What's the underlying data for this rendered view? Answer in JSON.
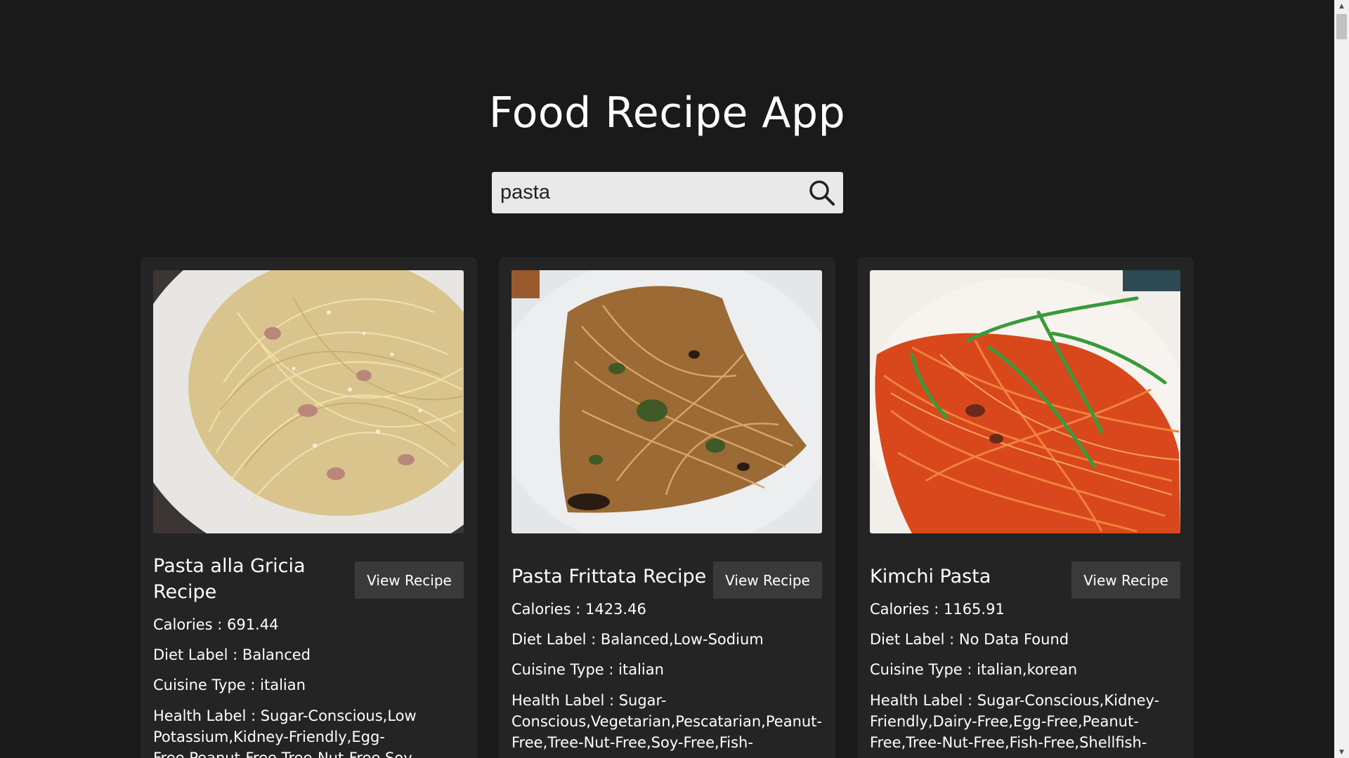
{
  "app": {
    "title": "Food Recipe App"
  },
  "search": {
    "value": "pasta",
    "icon": "magnifier"
  },
  "recipes": [
    {
      "title": "Pasta alla Gricia Recipe",
      "button_label": "View Recipe",
      "calories": "Calories : 691.44",
      "diet": "Diet Label : Balanced",
      "cuisine": "Cuisine Type : italian",
      "health": "Health Label : Sugar-Conscious,Low Potassium,Kidney-Friendly,Egg-Free,Peanut-Free,Tree-Nut-Free,Soy-",
      "image_colors": [
        "#d8c79a",
        "#efe3bd",
        "#3a3330"
      ]
    },
    {
      "title": "Pasta Frittata Recipe",
      "button_label": "View Recipe",
      "calories": "Calories : 1423.46",
      "diet": "Diet Label : Balanced,Low-Sodium",
      "cuisine": "Cuisine Type : italian",
      "health": "Health Label : Sugar-Conscious,Vegetarian,Pescatarian,Peanut-Free,Tree-Nut-Free,Soy-Free,Fish-",
      "image_colors": [
        "#b98448",
        "#e9ecef",
        "#3d4a25"
      ]
    },
    {
      "title": "Kimchi Pasta",
      "button_label": "View Recipe",
      "calories": "Calories : 1165.91",
      "diet": "Diet Label : No Data Found",
      "cuisine": "Cuisine Type : italian,korean",
      "health": "Health Label : Sugar-Conscious,Kidney-Friendly,Dairy-Free,Egg-Free,Peanut-Free,Tree-Nut-Free,Fish-Free,Shellfish-",
      "image_colors": [
        "#e0622b",
        "#f3f0ec",
        "#3a9a3a"
      ]
    }
  ],
  "colors": {
    "background": "#1a1a1b",
    "card": "#242425",
    "button": "#3a3a3b",
    "search_bg": "#e9e9e9"
  }
}
